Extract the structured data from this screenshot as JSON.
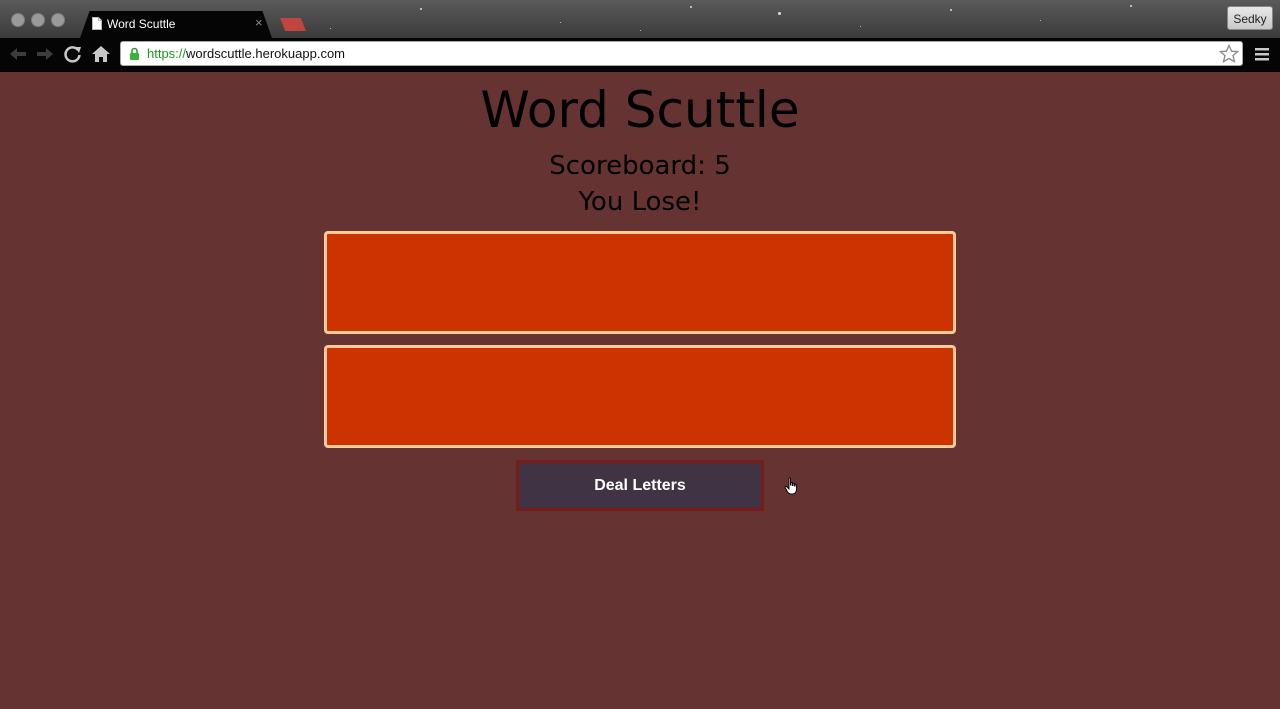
{
  "browser": {
    "tab_title": "Word Scuttle",
    "tab_close": "×",
    "profile_name": "Sedky",
    "url_scheme": "https://",
    "url_host": "wordscuttle.herokuapp.com"
  },
  "game": {
    "title": "Word Scuttle",
    "score_label": "Scoreboard: ",
    "score_value": "5",
    "result_message": "You Lose!",
    "deal_button_label": "Deal Letters"
  },
  "colors": {
    "page_background": "#663333",
    "letter_box_fill": "#cc3300",
    "letter_box_border": "#ffcc99",
    "deal_button_fill": "#3f3344",
    "deal_button_border": "#7a1a1a"
  },
  "icons": {
    "back": "back-arrow-icon",
    "forward": "forward-arrow-icon",
    "reload": "reload-icon",
    "home": "home-icon",
    "lock": "lock-icon",
    "bookmark": "star-icon",
    "menu": "hamburger-menu-icon",
    "page": "document-icon",
    "cursor": "hand-pointer-icon"
  }
}
